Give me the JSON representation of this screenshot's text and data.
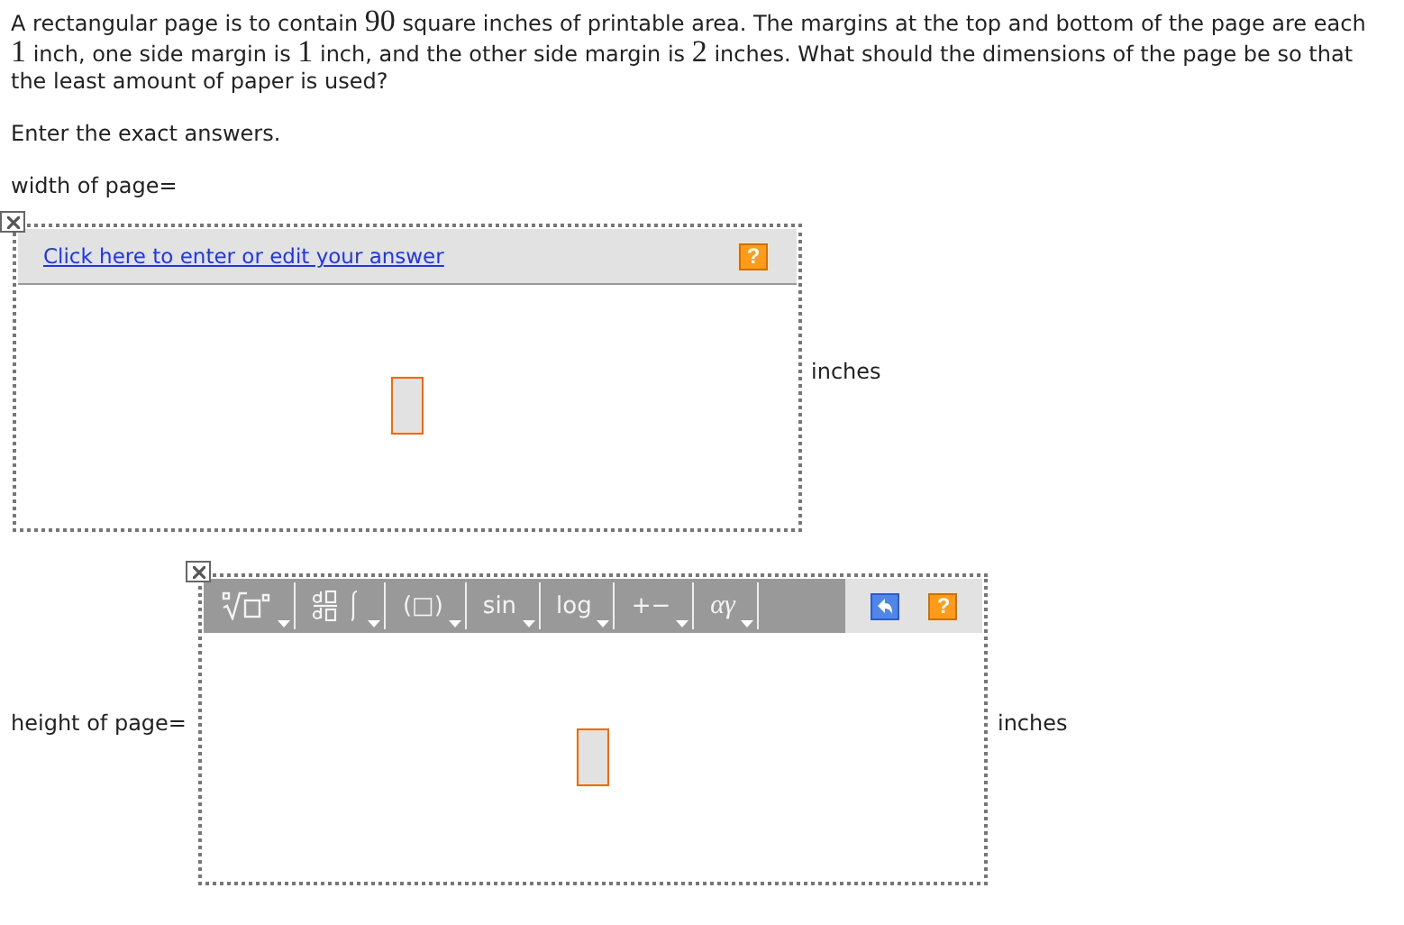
{
  "question": [
    {
      "kind": "text",
      "text": "A rectangular page is to contain "
    },
    {
      "kind": "math",
      "text": "90"
    },
    {
      "kind": "text",
      "text": " square inches of printable area. The margins at the top and bottom of the page are each "
    },
    {
      "kind": "math",
      "text": "1"
    },
    {
      "kind": "text",
      "text": " inch, one side margin is "
    },
    {
      "kind": "math",
      "text": "1"
    },
    {
      "kind": "text",
      "text": " inch, and the other side margin is "
    },
    {
      "kind": "math",
      "text": "2"
    },
    {
      "kind": "text",
      "text": " inches. What should the dimensions of the page be so that the least amount of paper is used?"
    }
  ],
  "instruction": "Enter the exact answers.",
  "answers": [
    {
      "label": "width of page=",
      "unit": "inches",
      "editor": {
        "kind": "link",
        "link": "Click here to enter or edit your answer",
        "help": "?"
      }
    },
    {
      "label": "height of page=",
      "unit": "inches",
      "editor": {
        "kind": "toolbar",
        "help": "?",
        "tools": [
          {
            "kind": "radical"
          },
          {
            "kind": "calculus"
          },
          {
            "kind": "text",
            "text": "(□)"
          },
          {
            "kind": "text",
            "text": "sin"
          },
          {
            "kind": "text",
            "text": "log"
          },
          {
            "kind": "text",
            "text": "+−"
          },
          {
            "kind": "greek",
            "text": "αγ"
          }
        ]
      }
    }
  ]
}
